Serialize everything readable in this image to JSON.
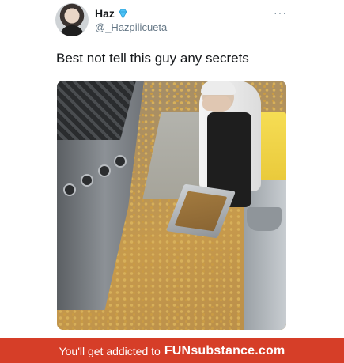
{
  "tweet": {
    "display_name": "Haz",
    "handle": "@_Hazpilicueta",
    "text": "Best not tell this guy any secrets",
    "more_glyph": "···",
    "verified_icon": "verified-diamond-icon"
  },
  "footer": {
    "prefix": "You'll get addicted to",
    "brand_bold": "FUN",
    "brand_rest": "substance",
    "brand_suffix": ".com",
    "color": "#d63e28"
  }
}
